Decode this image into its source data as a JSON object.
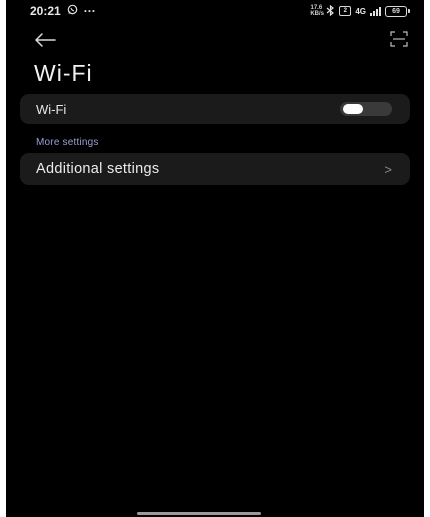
{
  "status_bar": {
    "time": "20:21",
    "left_icons": [
      "whatsapp-icon",
      "more-notifications-icon"
    ],
    "more_dots": "···",
    "net_speed": "17.6 KB/s",
    "sim_label": "2",
    "network_label": "4G",
    "battery_level": "69",
    "right_icons": [
      "bluetooth-icon",
      "sim-icon",
      "signal-icon",
      "battery-icon"
    ]
  },
  "toolbar": {
    "back_icon": "arrow-left-icon",
    "scan_icon": "scan-qr-icon"
  },
  "page": {
    "title": "Wi-Fi"
  },
  "wifi_toggle": {
    "label": "Wi-Fi",
    "enabled": false
  },
  "more_settings": {
    "header": "More settings",
    "items": [
      {
        "label": "Additional settings",
        "chevron": ">"
      }
    ]
  },
  "colors": {
    "background": "#000000",
    "card": "#1b1b1b",
    "section_header": "#9aa0d6",
    "text": "#ececec"
  }
}
